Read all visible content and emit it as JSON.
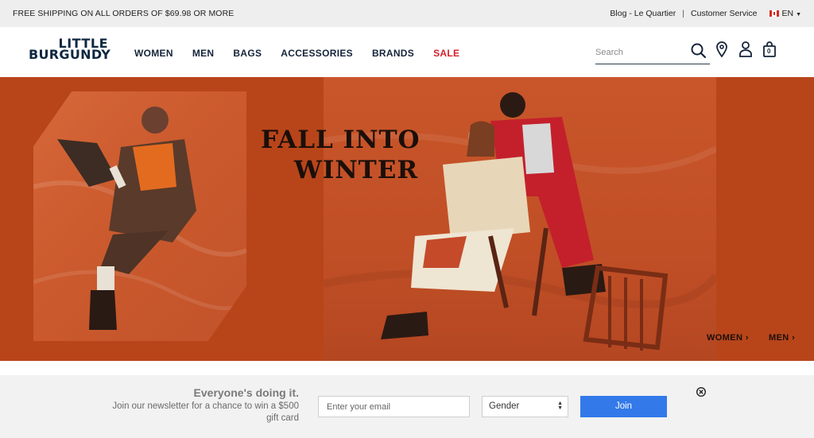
{
  "topbar": {
    "shipping": "FREE SHIPPING ON ALL ORDERS OF $69.98 OR MORE",
    "blog": "Blog - Le Quartier",
    "separator": "|",
    "customer_service": "Customer Service",
    "language": "EN"
  },
  "header": {
    "logo_line1": "LITTLE",
    "logo_line2": "BURGUNDY",
    "nav": [
      "WOMEN",
      "MEN",
      "BAGS",
      "ACCESSORIES",
      "BRANDS",
      "SALE"
    ],
    "search_placeholder": "Search",
    "icons": [
      "search-icon",
      "location-pin-icon",
      "account-icon",
      "cart-icon"
    ],
    "cart_count": "0"
  },
  "hero": {
    "headline_line1": "FALL INTO",
    "headline_line2": "WINTER",
    "link_women": "WOMEN",
    "link_men": "MEN",
    "chevron": "›"
  },
  "newsletter": {
    "title": "Everyone's doing it.",
    "text": "Join our newsletter for a chance to win a $500 gift card",
    "email_placeholder": "Enter your email",
    "gender_value": "Gender",
    "join_label": "Join"
  },
  "colors": {
    "hero_bg": "#b8451a",
    "sale": "#d4212b",
    "join_button": "#3379ea",
    "logo": "#0f2740"
  }
}
